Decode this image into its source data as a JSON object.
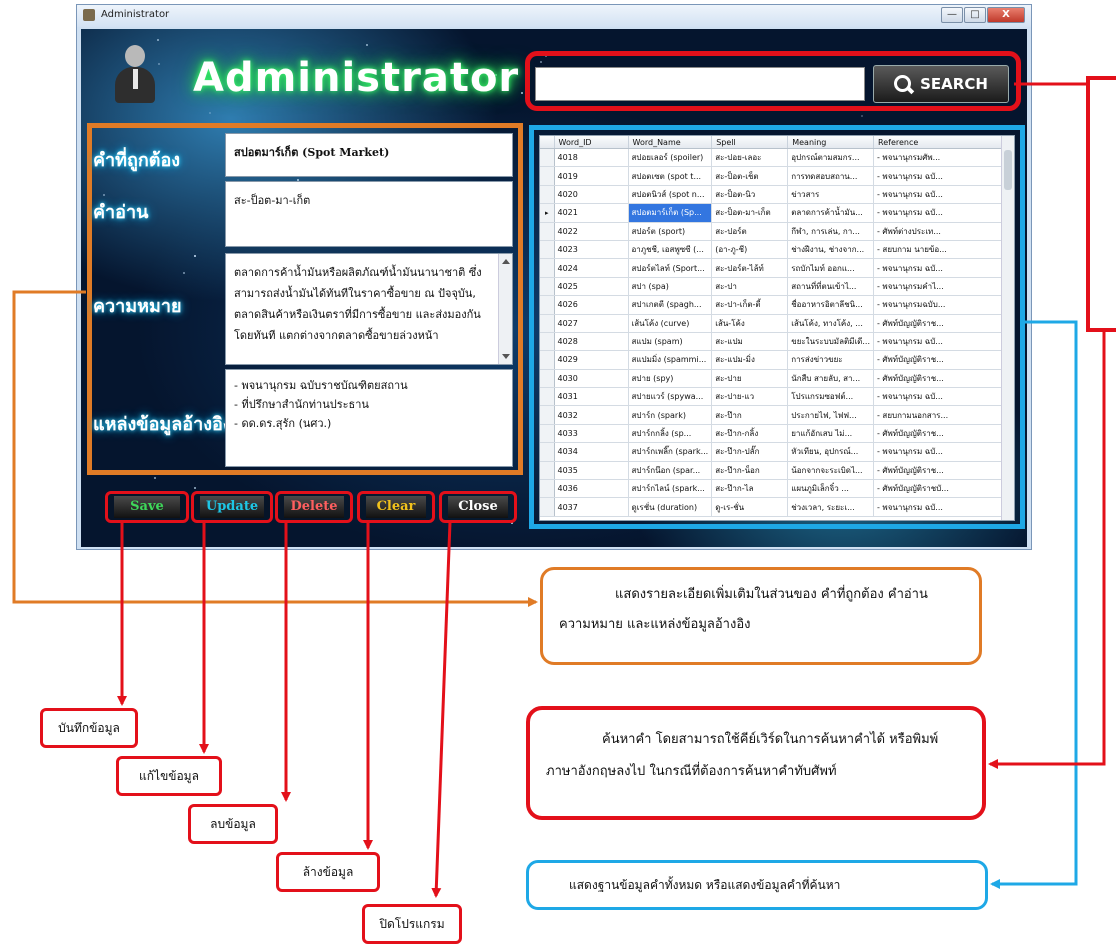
{
  "window": {
    "title": "Administrator",
    "minimize_glyph": "—",
    "maximize_glyph": "□",
    "close_glyph": "X"
  },
  "header": {
    "app_title": "Administrator"
  },
  "search": {
    "value": "",
    "button_label": "SEARCH",
    "icon": "magnifier-icon"
  },
  "details": {
    "word_label": "คำที่ถูกต้อง",
    "word_value": "สปอตมาร์เก็ต (Spot Market)",
    "spell_label": "คำอ่าน",
    "spell_value": "สะ-ป็อต-มา-เก็ต",
    "meaning_label": "ความหมาย",
    "meaning_value": "ตลาดการค้าน้ำมันหรือผลิตภัณฑ์น้ำมันนานาชาติ ซึ่งสามารถส่งน้ำมันได้ทันทีในราคาซื้อขาย ณ ปัจจุบัน, ตลาดสินค้าหรือเงินตราที่มีการซื้อขาย และส่งมองกันโดยทันที แตกต่างจากตลาดซื้อขายล่วงหน้า",
    "reference_label": "แหล่งข้อมูลอ้างอิง",
    "reference_lines": [
      "- พจนานุกรม ฉบับราชบัณฑิตยสถาน",
      "- ที่ปรึกษาสำนักท่านประธาน",
      "- ดด.ดร.สุรัก (นศว.)"
    ]
  },
  "buttons": {
    "save": {
      "label": "Save",
      "color": "#3ed85a"
    },
    "update": {
      "label": "Update",
      "color": "#1ec6e6"
    },
    "delete": {
      "label": "Delete",
      "color": "#ff5f5f"
    },
    "clear": {
      "label": "Clear",
      "color": "#f2c21c"
    },
    "close": {
      "label": "Close",
      "color": "#ffffff"
    }
  },
  "grid": {
    "columns": [
      "Word_ID",
      "Word_Name",
      "Spell",
      "Meaning",
      "Reference"
    ],
    "selected_row_index": 3,
    "rows": [
      [
        "4018",
        "สปอยเลอร์ (spoiler)",
        "สะ-ปอย-เลอะ",
        "อุปกรณ์ตามสมกร...",
        "- พจนานุกรมศัพ..."
      ],
      [
        "4019",
        "สปอตเซต (spot t...",
        "สะ-ป็อต-เช็ต",
        "การทดสอบสถาน...",
        "- พจนานุกรม ฉบั..."
      ],
      [
        "4020",
        "สปอตนิวส์ (spot n...",
        "สะ-ป็อต-นิว",
        "ข่าวสาร",
        "- พจนานุกรม ฉบั..."
      ],
      [
        "4021",
        "สปอตมาร์เก็ต (Sp...",
        "สะ-ป็อต-มา-เก็ต",
        "ตลาดการค้าน้ำมัน...",
        "- พจนานุกรม ฉบั..."
      ],
      [
        "4022",
        "สปอร์ต (sport)",
        "สะ-ปอร์ต",
        "กีฬา, การเล่น, กา...",
        "- ศัพท์ต่างประเท..."
      ],
      [
        "4023",
        "อาภูชชี, เอสพูซซี (...",
        "(อา-ภู-ชี)",
        "ช่างฝีงาน, ช่างจาก...",
        "- สยบกาม นายข้อ..."
      ],
      [
        "4024",
        "สปอร์ตไลท์ (Sport...",
        "สะ-ปอร์ต-ไล้ท์",
        "รถบักไมท์ ออกแ...",
        "- พจนานุกรม ฉบั..."
      ],
      [
        "4025",
        "สปา (spa)",
        "สะ-ปา",
        "สถานที่ที่ตนเข้าไ...",
        "- พจนานุกรมคำไ..."
      ],
      [
        "4026",
        "สปาเกตตี (spagh...",
        "สะ-ปา-เก็ต-ตี้",
        "ชื่ออาหารอิตาลีชนิ...",
        "- พจนานุกรมฉบับ..."
      ],
      [
        "4027",
        "เส้นโค้ง (curve)",
        "เส้น-โค้ง",
        "เส้นโค้ง, ทางโค้ง, ...",
        "- ศัพท์บัญญัติราช..."
      ],
      [
        "4028",
        "สแปม (spam)",
        "สะ-แปม",
        "ขยะในระบบมัลติมีเดี...",
        "- พจนานุกรม ฉบั..."
      ],
      [
        "4029",
        "สแปมมิ่ง (spammi...",
        "สะ-แปม-มิ่ง",
        "การส่งข่าวขยะ",
        "- ศัพท์บัญญัติราช..."
      ],
      [
        "4030",
        "สปาย (spy)",
        "สะ-ปาย",
        "นักสืบ สายลับ, สา...",
        "- ศัพท์บัญญัติราช..."
      ],
      [
        "4031",
        "สปายแวร์ (spywa...",
        "สะ-ปาย-แว",
        "โปรแกรมซอฟต์...",
        "- พจนานุกรม ฉบั..."
      ],
      [
        "4032",
        "สปาร์ก (spark)",
        "สะ-ป๊าก",
        "ประกายไฟ, ไฟฟ...",
        "- สยบกามนอกสาร..."
      ],
      [
        "4033",
        "สปาร์กกลิ้ง (sp...",
        "สะ-ป๊าก-กลิ้ง",
        "ยาแก้อักเสบ ไม่...",
        "- ศัพท์บัญญัติราช..."
      ],
      [
        "4034",
        "สปาร์กเพลิ๊ก (spark...",
        "สะ-ป๊าก-ปลั๊ก",
        "หัวเทียน, อุปกรณ์...",
        "- พจนานุกรม ฉบั..."
      ],
      [
        "4035",
        "สปาร์กน๊อก (spar...",
        "สะ-ป๊าก-น็อก",
        "น้อกจากจะระเบิดไ...",
        "- ศัพท์บัญญัติราช..."
      ],
      [
        "4036",
        "สปาร์กไลน์ (spark...",
        "สะ-ป๊าก-ไล",
        "แผนภูมิเล็กจิ๋ว ...",
        "- ศัพท์บัญญัติราชบั..."
      ],
      [
        "4037",
        "ดูเรชั่น (duration)",
        "ดู-เร-ชั่น",
        "ช่วงเวลา, ระยะเ...",
        "- พจนานุกรม ฉบั..."
      ]
    ]
  },
  "annotations": {
    "details_callout": [
      "แสดงรายละเอียดเพิ่มเติมในส่วนของ คำที่ถูกต้อง คำอ่าน",
      "ความหมาย และแหล่งข้อมูลอ้างอิง"
    ],
    "search_callout": [
      "ค้นหาคำ โดยสามารถใช้คีย์เวิร์ดในการค้นหาคำได้ หรือพิมพ์",
      "ภาษาอังกฤษลงไป ในกรณีที่ต้องการค้นหาคำทับศัพท์"
    ],
    "grid_callout": "แสดงฐานข้อมูลคำทั้งหมด หรือแสดงข้อมูลคำที่ค้นหา",
    "save_label": "บันทึกข้อมูล",
    "update_label": "แก้ไขข้อมูล",
    "delete_label": "ลบข้อมูล",
    "clear_label": "ล้างข้อมูล",
    "close_label": "ปิดโปรแกรม"
  },
  "colors": {
    "orange": "#e07b26",
    "red": "#e3101a",
    "blue": "#1ea8e6",
    "title_glow": "#3cff6a"
  }
}
